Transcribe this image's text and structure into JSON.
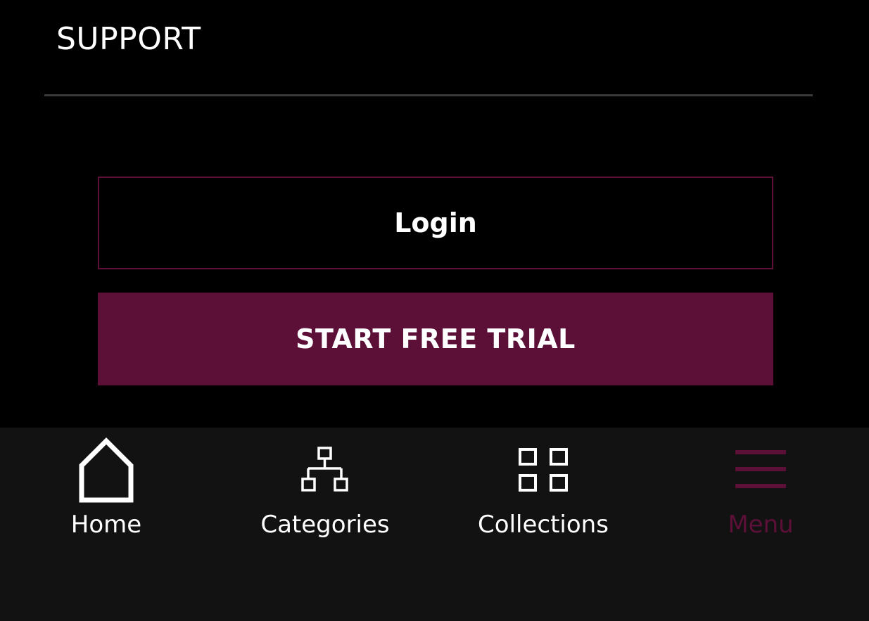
{
  "support": {
    "title": "SUPPORT"
  },
  "actions": {
    "login_label": "Login",
    "trial_label": "START FREE TRIAL"
  },
  "tabbar": {
    "items": [
      {
        "label": "Home",
        "icon": "home-icon",
        "active": false
      },
      {
        "label": "Categories",
        "icon": "hierarchy-icon",
        "active": false
      },
      {
        "label": "Collections",
        "icon": "grid-icon",
        "active": false
      },
      {
        "label": "Menu",
        "icon": "hamburger-icon",
        "active": true
      }
    ]
  },
  "colors": {
    "background": "#000000",
    "accent": "#5c1038",
    "tabbar_background": "#121212",
    "divider": "#3a3a3a",
    "text": "#ffffff"
  }
}
